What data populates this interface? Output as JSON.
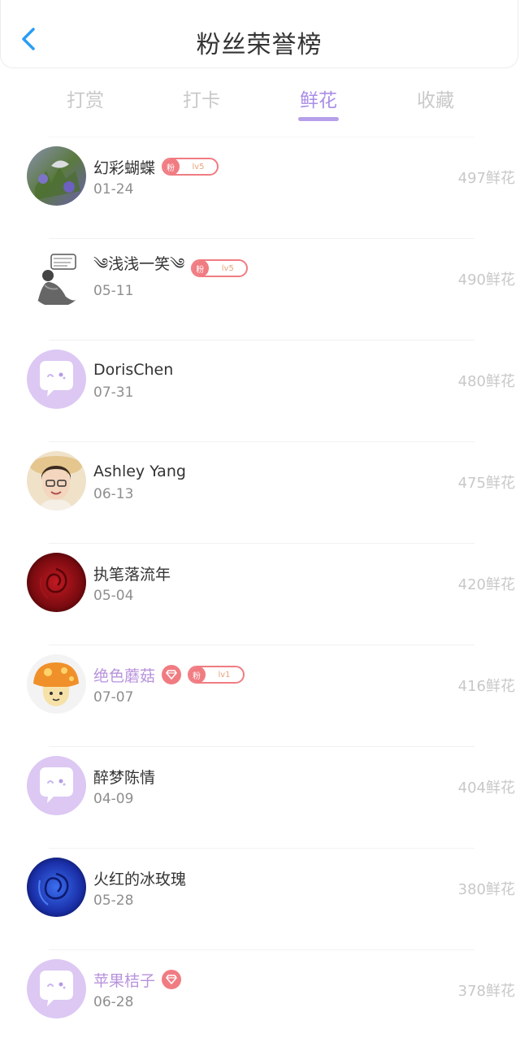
{
  "header": {
    "title": "粉丝荣誉榜",
    "accent": "#2a9df4"
  },
  "tabs": [
    {
      "label": "打赏",
      "active": false
    },
    {
      "label": "打卡",
      "active": false
    },
    {
      "label": "鲜花",
      "active": true
    },
    {
      "label": "收藏",
      "active": false
    }
  ],
  "colors": {
    "active_tab": "#a98ee6",
    "badge": "#f07c82",
    "vip_name": "#b892dc"
  },
  "fans": [
    {
      "name": "幻彩蝴蝶",
      "date": "01-24",
      "score": "497鲜花",
      "avatar": "butterfly-avatar",
      "badge": {
        "fan": "粉",
        "level": "lv5"
      },
      "vip": false
    },
    {
      "name": "༄浅浅一笑༄",
      "date": "05-11",
      "score": "490鲜花",
      "avatar": "ink-figure-avatar",
      "badge": {
        "fan": "粉",
        "level": "lv5"
      },
      "vip": false
    },
    {
      "name": "DorisChen",
      "date": "07-31",
      "score": "480鲜花",
      "avatar": "default-chat-avatar",
      "badge": null,
      "vip": false
    },
    {
      "name": "Ashley Yang",
      "date": "06-13",
      "score": "475鲜花",
      "avatar": "woman-photo-avatar",
      "badge": null,
      "vip": false
    },
    {
      "name": "执笔落流年",
      "date": "05-04",
      "score": "420鲜花",
      "avatar": "red-rose-avatar",
      "badge": null,
      "vip": false
    },
    {
      "name": "绝色蘑菇",
      "date": "07-07",
      "score": "416鲜花",
      "avatar": "mushroom-avatar",
      "badge": {
        "fan": "粉",
        "level": "lv1"
      },
      "vip": true
    },
    {
      "name": "醉梦陈情",
      "date": "04-09",
      "score": "404鲜花",
      "avatar": "default-chat-avatar",
      "badge": null,
      "vip": false
    },
    {
      "name": "火红的冰玫瑰",
      "date": "05-28",
      "score": "380鲜花",
      "avatar": "blue-rose-avatar",
      "badge": null,
      "vip": false
    },
    {
      "name": "苹果桔子",
      "date": "06-28",
      "score": "378鲜花",
      "avatar": "default-chat-avatar",
      "badge": null,
      "vip": true
    }
  ]
}
